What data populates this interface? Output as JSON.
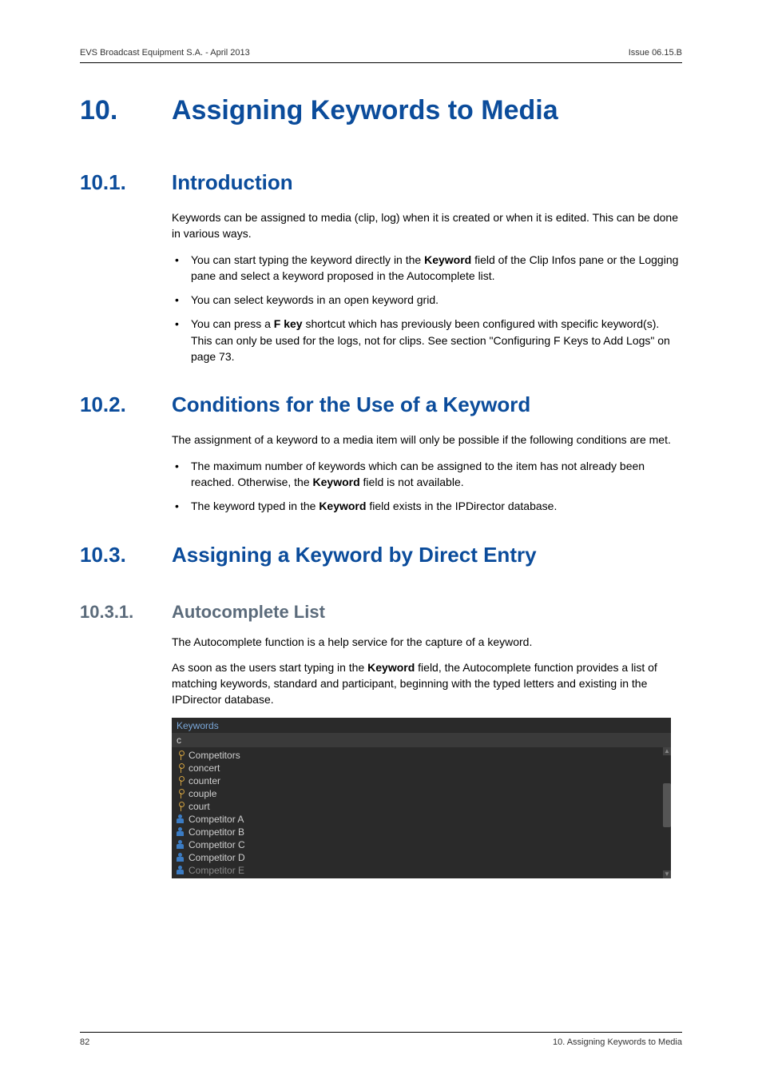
{
  "header": {
    "left": "EVS Broadcast Equipment S.A.  - April 2013",
    "right": "Issue 06.15.B"
  },
  "h1": {
    "num": "10.",
    "title": "Assigning Keywords to Media"
  },
  "s1": {
    "num": "10.1.",
    "title": "Introduction",
    "p1": "Keywords can be assigned to media (clip, log) when it is created or when it is edited. This can be done in various ways.",
    "b1a": "You can start typing the keyword directly in the ",
    "b1k": "Keyword",
    "b1b": " field of the Clip Infos pane or the Logging pane and select a keyword proposed in the Autocomplete list.",
    "b2": "You can select keywords in an open keyword grid.",
    "b3a": "You can press a ",
    "b3k": "F key",
    "b3b": " shortcut which has previously been configured with specific keyword(s). This can only be used for the logs, not for clips. See section \"Configuring F Keys to Add Logs\" on page 73."
  },
  "s2": {
    "num": "10.2.",
    "title": "Conditions for the Use of a Keyword",
    "p1": "The assignment of a keyword to a media item will only be possible if the following conditions are met.",
    "b1a": "The maximum number of keywords which can be assigned to the item has not already been reached. Otherwise, the ",
    "b1k": "Keyword",
    "b1b": " field is not available.",
    "b2a": "The keyword typed in the ",
    "b2k": "Keyword",
    "b2b": " field exists in the IPDirector database."
  },
  "s3": {
    "num": "10.3.",
    "title": "Assigning a Keyword by Direct Entry",
    "sub_num": "10.3.1.",
    "sub_title": "Autocomplete List",
    "p1": "The Autocomplete function is a help service for the capture of a keyword.",
    "p2a": "As soon as the users start typing in the ",
    "p2k": "Keyword",
    "p2b": " field, the Autocomplete function provides a list of matching keywords, standard and participant, beginning with the typed letters and existing in the IPDirector database."
  },
  "ui": {
    "label": "Keywords",
    "input": "c",
    "items": [
      {
        "text": "Competitors",
        "type": "key"
      },
      {
        "text": "concert",
        "type": "key"
      },
      {
        "text": "counter",
        "type": "key"
      },
      {
        "text": "couple",
        "type": "key"
      },
      {
        "text": "court",
        "type": "key"
      },
      {
        "text": "Competitor A",
        "type": "person"
      },
      {
        "text": "Competitor B",
        "type": "person"
      },
      {
        "text": "Competitor C",
        "type": "person"
      },
      {
        "text": "Competitor D",
        "type": "person"
      },
      {
        "text": "Competitor E",
        "type": "person"
      }
    ]
  },
  "footer": {
    "left": "82",
    "right": "10. Assigning Keywords to Media"
  }
}
